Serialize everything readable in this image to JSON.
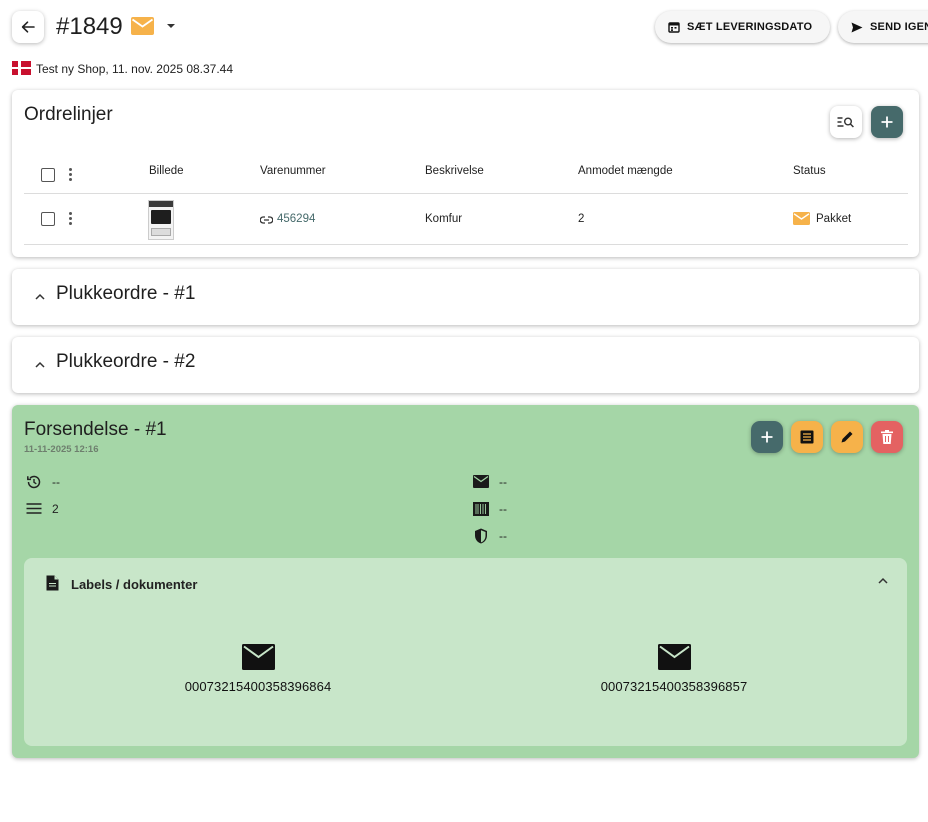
{
  "header": {
    "order_number": "#1849",
    "buttons": {
      "set_delivery_date": "SÆT LEVERINGSDATO",
      "send_again": "SEND IGEN"
    },
    "shop_info": "Test ny Shop, 11. nov. 2025 08.37.44"
  },
  "order_lines": {
    "title": "Ordrelinjer",
    "columns": [
      "Billede",
      "Varenummer",
      "Beskrivelse",
      "Anmodet mængde",
      "Status"
    ],
    "rows": [
      {
        "sku": "456294",
        "description": "Komfur",
        "requested_qty": "2",
        "status": "Pakket"
      }
    ]
  },
  "pick_orders": [
    {
      "title": "Plukkeordre - #1"
    },
    {
      "title": "Plukkeordre - #2"
    }
  ],
  "shipment": {
    "title": "Forsendelse - #1",
    "date": "11-11-2025 12:16",
    "info": {
      "history": "--",
      "lines": "2",
      "email": "--",
      "barcode": "--",
      "insurance": "--"
    },
    "labels_panel": {
      "title": "Labels / dokumenter",
      "labels": [
        "00073215400358396864",
        "00073215400358396857"
      ]
    }
  },
  "colors": {
    "accent_teal": "#466a6b",
    "accent_orange": "#f6b24a",
    "danger_red": "#e46262",
    "shipment_bg": "#a5d6a7",
    "labels_bg": "#c8e6c9"
  }
}
